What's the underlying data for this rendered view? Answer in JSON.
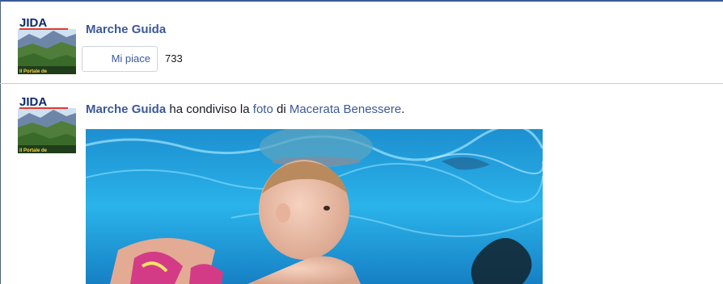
{
  "page": {
    "name": "Marche Guida",
    "like_button_label": "Mi piace",
    "like_count": "733",
    "logo_text": "JIDA",
    "logo_subtext": "Il Portale de"
  },
  "post": {
    "author": "Marche Guida",
    "text_shared": " ha condiviso la ",
    "photo_link": "foto",
    "text_of": " di ",
    "source": "Macerata Benessere",
    "period": ".",
    "avatar_text": "JIDA",
    "avatar_subtext": "Il Portale de"
  },
  "colors": {
    "link": "#3b5998",
    "water": "#2ab3ea"
  },
  "icons": {
    "page_logo": "marche-guida-logo-icon",
    "post_avatar": "marche-guida-avatar-icon"
  }
}
